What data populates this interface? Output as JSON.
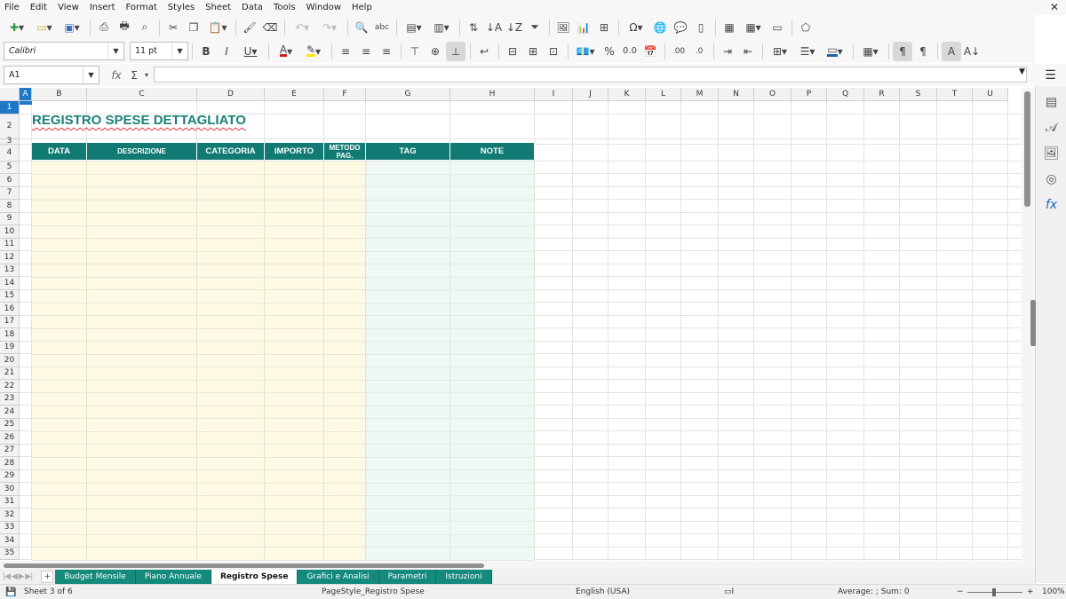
{
  "menu": [
    "File",
    "Edit",
    "View",
    "Insert",
    "Format",
    "Styles",
    "Sheet",
    "Data",
    "Tools",
    "Window",
    "Help"
  ],
  "toolbar": {
    "font_name": "Calibri",
    "font_size": "11 pt",
    "bold": "B",
    "italic": "I",
    "underline": "U",
    "percent": "%",
    "decimal": "0.0"
  },
  "formula_bar": {
    "name_box": "A1",
    "fx": "fx",
    "sum": "Σ",
    "equals": "=",
    "content": ""
  },
  "columns": [
    "A",
    "B",
    "C",
    "D",
    "E",
    "F",
    "G",
    "H",
    "I",
    "J",
    "K",
    "L",
    "M",
    "N",
    "O",
    "P",
    "Q",
    "R",
    "S",
    "T",
    "U"
  ],
  "selected_column": "A",
  "rows": [
    "1",
    "2",
    "3",
    "4",
    "5",
    "6",
    "7",
    "8",
    "9",
    "10",
    "11",
    "12",
    "13",
    "14",
    "15",
    "16",
    "17",
    "18",
    "19",
    "20",
    "21",
    "22",
    "23",
    "24",
    "25",
    "26",
    "27",
    "28",
    "29",
    "30",
    "31",
    "32",
    "33",
    "34",
    "35"
  ],
  "selected_row": "1",
  "sheet": {
    "title": "REGISTRO SPESE DETTAGLIATO",
    "headers": [
      "DATA",
      "DESCRIZIONE",
      "CATEGORIA",
      "IMPORTO",
      "METODO PAG.",
      "TAG",
      "NOTE"
    ],
    "accent_color": "#117a72",
    "title_color": "#19807a",
    "input_fill": "#fdf9e3",
    "tag_fill": "#eef8f5"
  },
  "tabs": [
    "Budget Mensile",
    "Piano Annuale",
    "Registro Spese",
    "Grafici e Analisi",
    "Parametri",
    "Istruzioni"
  ],
  "active_tab": "Registro Spese",
  "status": {
    "sheet": "Sheet 3 of 6",
    "page_style": "PageStyle_Registro Spese",
    "language": "English (USA)",
    "summary": "Average: ; Sum: 0",
    "zoom": "100%"
  }
}
